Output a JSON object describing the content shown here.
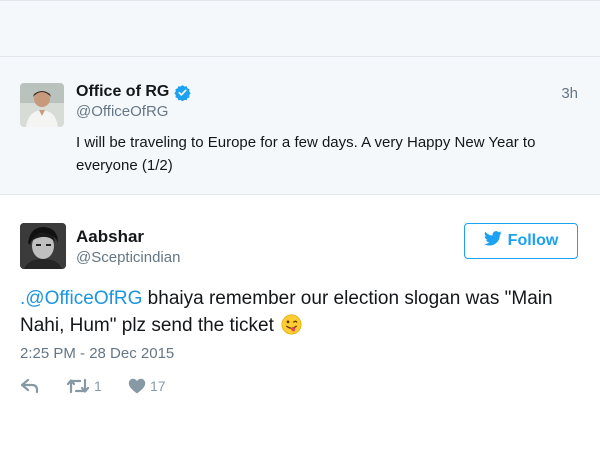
{
  "parent_tweet": {
    "name": "Office of RG",
    "handle": "@OfficeOfRG",
    "time": "3h",
    "text": "I will be traveling to Europe for a few days. A very Happy New Year to everyone (1/2)",
    "verified_icon": "verified-badge-icon"
  },
  "tweet": {
    "name": "Aabshar",
    "handle": "@Scepticindian",
    "follow_label": "Follow",
    "mention": ".@OfficeOfRG",
    "text": " bhaiya remember our election slogan was \"Main Nahi, Hum\" plz send the ticket",
    "emoji": "winking-tongue-face-icon",
    "date": "2:25 PM - 28 Dec 2015",
    "actions": {
      "reply_icon": "reply-icon",
      "retweet_icon": "retweet-icon",
      "retweet_count": "1",
      "like_icon": "heart-icon",
      "like_count": "17"
    }
  },
  "colors": {
    "accent": "#1da1f2",
    "mention": "#1b95e0",
    "muted": "#657786",
    "panel": "#f5f8fa"
  }
}
